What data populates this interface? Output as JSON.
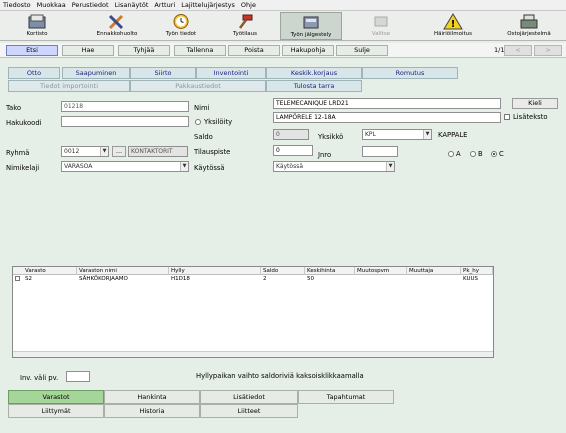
{
  "menu": [
    "Tiedosto",
    "Muokkaa",
    "Perustiedot",
    "Lisanäytöt",
    "Artturi",
    "Lajittelujärjestys",
    "Ohje"
  ],
  "toolbar": [
    {
      "label": "Kortisto",
      "icon": "card-index-icon"
    },
    {
      "label": "Ennakkohuolto",
      "icon": "tools-icon"
    },
    {
      "label": "Työn tiedot",
      "icon": "clock-icon"
    },
    {
      "label": "Työtilaus",
      "icon": "hammer-icon"
    },
    {
      "label": "Työn jälgestely",
      "icon": "archive-icon"
    },
    {
      "label": "Valitse",
      "icon": "disabled-icon"
    },
    {
      "label": "Häiriöilmoitus",
      "icon": "warning-icon"
    },
    {
      "label": "Ostojärjestelmä",
      "icon": "cash-register-icon"
    }
  ],
  "actions": [
    "Etsi",
    "Hae",
    "Tyhjää",
    "Tallenna",
    "Poista",
    "Hakupohja",
    "Sulje"
  ],
  "pager": {
    "count": "1/1",
    "prev": "<",
    "next": ">"
  },
  "functions": {
    "otto": "Otto",
    "saapuminen": "Saapuminen",
    "siirto": "Siirto",
    "inventointi": "Inventointi",
    "keskikorjaus": "Keskik.korjaus",
    "romutus": "Romutus",
    "tiedot_importointi": "Tiedot importointi",
    "pakkaus": "Pakkaustiedot",
    "tulosta_tarra": "Tulosta tarra"
  },
  "form": {
    "tako_label": "Tako",
    "tako_value": "01218",
    "hakukoodi_label": "Hakukoodi",
    "hakukoodi_value": "",
    "nimi_label": "Nimi",
    "nimi_value": "TELEMECANIQUE LRD21",
    "nimi2_value": "LAMPÖRELE 12-18A",
    "kieli_button": "Kieli",
    "lisateksto_label": "Lisäteksto",
    "yksiloity_label": "Yksilöity",
    "saldo_label": "Saldo",
    "saldo_value": "0",
    "yksikko_label": "Yksikkö",
    "yksikko_value": "KPL",
    "yksikko_text": "KAPPALE",
    "tilauspiste_label": "Tilauspiste",
    "tilauspiste_value": "0",
    "jnro_label": "Jnro",
    "jnro_value": "",
    "ryhma_label": "Ryhmä",
    "ryhma_value": "0012",
    "ryhma_button": "...",
    "ryhma_name": "KONTAKTORIT",
    "nimikelaji_label": "Nimikelaji",
    "nimikelaji_value": "VARASOA",
    "kaytossa_label": "Käytössä",
    "kaytossa_value": "Käytössä",
    "abc": [
      "A",
      "B",
      "C"
    ],
    "abc_selected": "C"
  },
  "table": {
    "columns": [
      "Varasto",
      "Varaston nimi",
      "Hylly",
      "Saldo",
      "Keskihinta",
      "Muutospvm",
      "Muuttaja",
      "Pk_hy"
    ],
    "rows": [
      [
        "S2",
        "SÄHKÖKORJAAMO",
        "H1D18",
        "2",
        "50",
        "",
        "",
        "KUUS"
      ]
    ]
  },
  "footer": {
    "inv_label": "Inv. väli pv.",
    "inv_value": "",
    "hint": "Hyllypaikan vaihto saldoriviä kaksoisklikkaamalla"
  },
  "tabs": [
    "Varastot",
    "Hankinta",
    "Lisätiedot",
    "Tapahtumat",
    "Liittymät",
    "Historia",
    "Liitteet"
  ]
}
